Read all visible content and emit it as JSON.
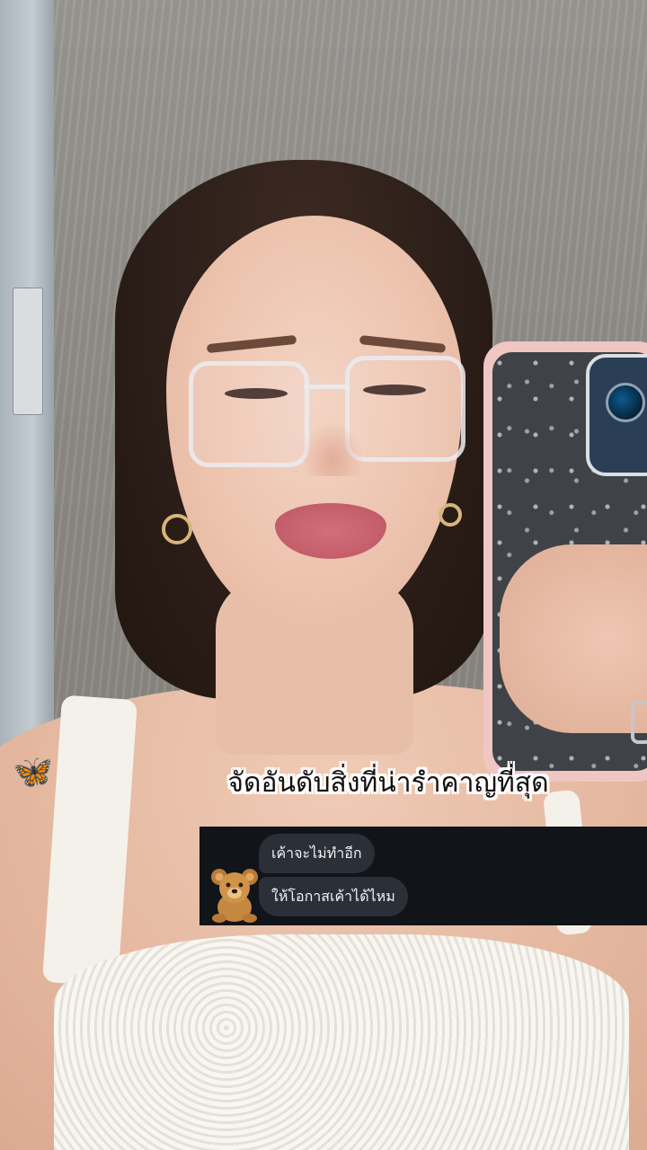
{
  "video": {
    "caption": "จัดอันดับสิ่งที่น่ารำคาญที่สุด",
    "scene_icon": "mirror-selfie-photo"
  },
  "chat": {
    "avatar_icon": "teddy-bear-icon",
    "messages": [
      "เค้าจะไม่ทำอีก",
      "ให้โอกาสเค้าได้ไหม"
    ]
  },
  "colors": {
    "chat_background": "#111419",
    "bubble_background": "#2b3038",
    "caption_text": "#111111",
    "caption_outline": "#ffffff"
  }
}
